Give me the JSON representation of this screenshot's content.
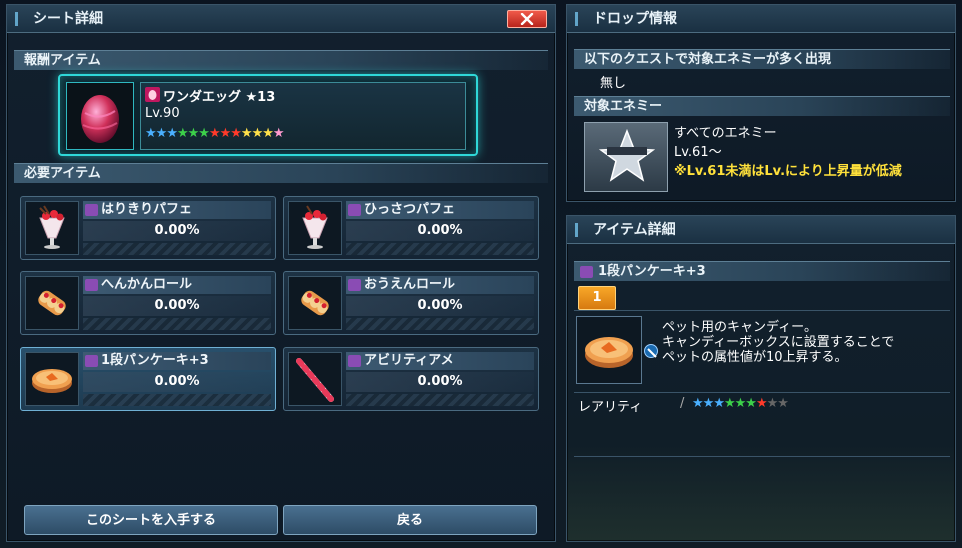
{
  "left_panel": {
    "title": "シート詳細",
    "reward_section": "報酬アイテム",
    "reward": {
      "name": "ワンダエッグ ★13",
      "level": "Lv.90",
      "star_colors": [
        "#4ab0ff",
        "#4ab0ff",
        "#4ab0ff",
        "#3cd04a",
        "#3cd04a",
        "#3cd04a",
        "#ff3a2a",
        "#ff3a2a",
        "#ff3a2a",
        "#ffe04a",
        "#ffe04a",
        "#ffe04a",
        "#ff9ad0"
      ]
    },
    "required_section": "必要アイテム",
    "items": [
      {
        "name": "はりきりパフェ",
        "pct": "0.00%",
        "icon": "parfait-icon"
      },
      {
        "name": "ひっさつパフェ",
        "pct": "0.00%",
        "icon": "parfait-icon"
      },
      {
        "name": "へんかんロール",
        "pct": "0.00%",
        "icon": "roll-cake-icon"
      },
      {
        "name": "おうえんロール",
        "pct": "0.00%",
        "icon": "roll-cake-icon"
      },
      {
        "name": "1段パンケーキ+3",
        "pct": "0.00%",
        "icon": "pancake-icon"
      },
      {
        "name": "アビリティアメ",
        "pct": "0.00%",
        "icon": "candy-cane-icon"
      }
    ],
    "buttons": {
      "get_sheet": "このシートを入手する",
      "back": "戻る"
    }
  },
  "drop_panel": {
    "title": "ドロップ情報",
    "quest_header": "以下のクエストで対象エネミーが多く出現",
    "quest_value": "無し",
    "enemy_header": "対象エネミー",
    "enemy_name": "すべてのエネミー",
    "enemy_level": "Lv.61～",
    "enemy_note": "※Lv.61未満はLv.により上昇量が低減"
  },
  "detail_panel": {
    "title": "アイテム詳細",
    "item_name": "1段パンケーキ+3",
    "tab_label": "1",
    "description_1": "ペット用のキャンディー。",
    "description_2": "キャンディーボックスに設置することで",
    "description_3": "ペットの属性値が10上昇する。",
    "rarity_label": "レアリティ",
    "rarity_stars": 7,
    "rarity_max": 9,
    "rarity_colors": [
      "#4ab0ff",
      "#4ab0ff",
      "#4ab0ff",
      "#3cd04a",
      "#3cd04a",
      "#3cd04a",
      "#ff3a2a",
      "#666666",
      "#666666"
    ]
  }
}
